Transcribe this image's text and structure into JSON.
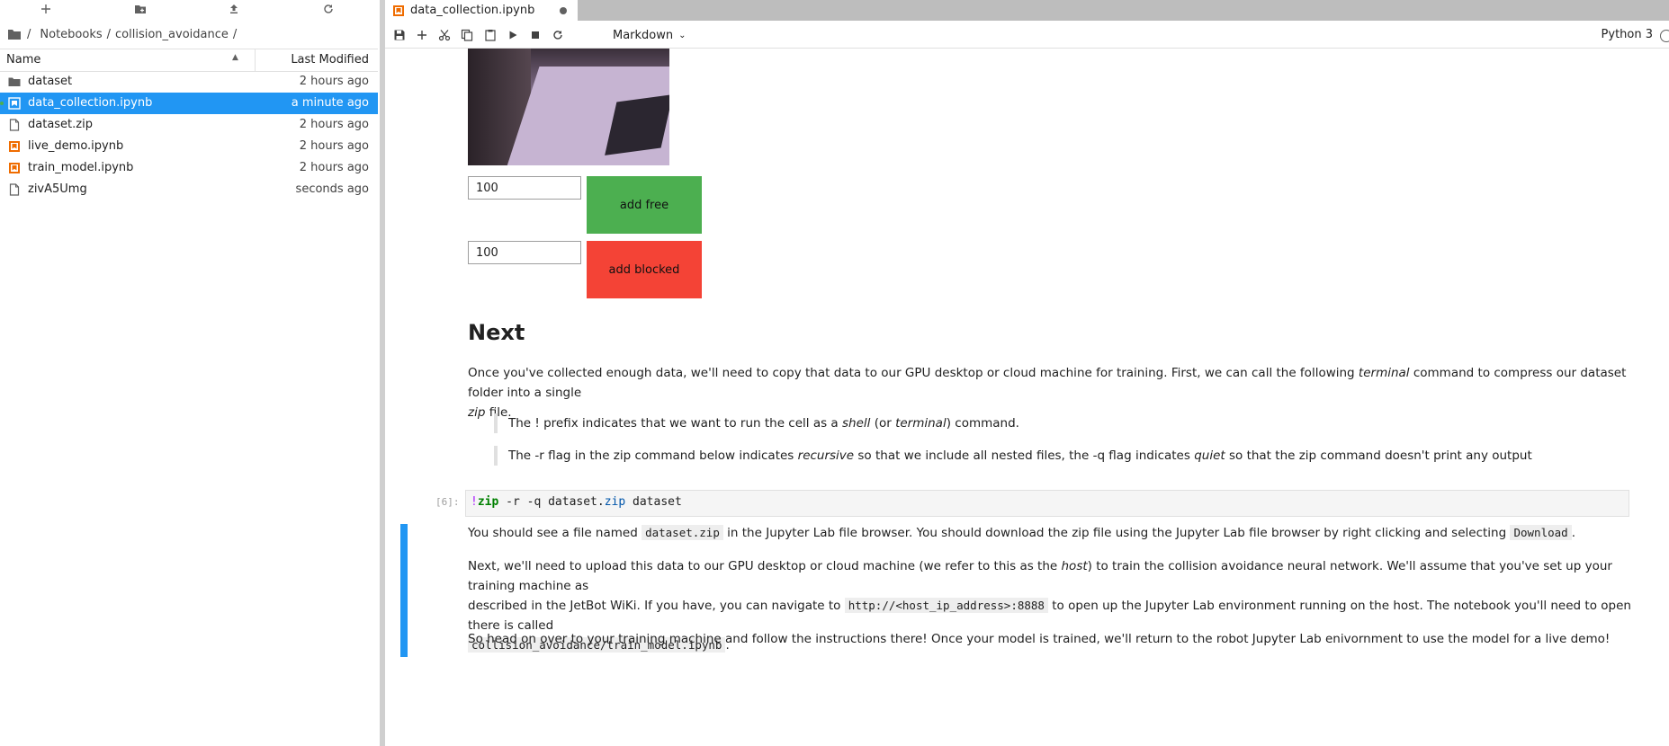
{
  "file_browser": {
    "toolbar": [
      {
        "name": "new-launcher-icon"
      },
      {
        "name": "new-folder-icon"
      },
      {
        "name": "upload-icon"
      },
      {
        "name": "refresh-icon"
      }
    ],
    "breadcrumb": {
      "root": "/",
      "parts": [
        "Notebooks",
        "collision_avoidance"
      ],
      "trailing": "/"
    },
    "header": {
      "name": "Name",
      "modified": "Last Modified"
    },
    "files": [
      {
        "name": "dataset",
        "modified": "2 hours ago",
        "icon": "folder-icon",
        "color": "#616161"
      },
      {
        "name": "data_collection.ipynb",
        "modified": "a minute ago",
        "icon": "notebook-icon",
        "color": "#ffffff",
        "selected": true
      },
      {
        "name": "dataset.zip",
        "modified": "2 hours ago",
        "icon": "file-icon",
        "color": "#616161"
      },
      {
        "name": "live_demo.ipynb",
        "modified": "2 hours ago",
        "icon": "notebook-icon",
        "color": "#ef6c00"
      },
      {
        "name": "train_model.ipynb",
        "modified": "2 hours ago",
        "icon": "notebook-icon",
        "color": "#ef6c00"
      },
      {
        "name": "zivA5Umg",
        "modified": "seconds ago",
        "icon": "file-icon",
        "color": "#616161"
      }
    ]
  },
  "notebook": {
    "tab": {
      "title": "data_collection.ipynb"
    },
    "toolbar": {
      "tools": [
        "save-icon",
        "add-cell-icon",
        "cut-icon",
        "copy-icon",
        "paste-icon",
        "run-icon",
        "stop-icon",
        "restart-icon"
      ],
      "cell_type": "Markdown",
      "kernel": "Python 3"
    },
    "widgets": {
      "free_value": "100",
      "free_label": "add free",
      "blocked_value": "100",
      "blocked_label": "add blocked",
      "free_color": "#4caf50",
      "blocked_color": "#f44336"
    },
    "next_heading": "Next",
    "p1": {
      "a": "Once you've collected enough data, we'll need to copy that data to our GPU desktop or cloud machine for training. First, we can call the following ",
      "em1": "terminal",
      "b": " command to compress our dataset folder into a single",
      "em2": "zip",
      "c": " file."
    },
    "quote1": {
      "a": "The ! prefix indicates that we want to run the cell as a ",
      "em1": "shell",
      "b": " (or ",
      "em2": "terminal",
      "c": ") command."
    },
    "quote2": {
      "a": "The -r flag in the zip command below indicates ",
      "em1": "recursive",
      "b": " so that we include all nested files, the -q flag indicates ",
      "em2": "quiet",
      "c": " so that the zip command doesn't print any output"
    },
    "code_cell": {
      "prompt": "[6]:",
      "bang": "!",
      "zip": "zip",
      "flags": " -r -q dataset.",
      "ext": "zip",
      "rest": " dataset"
    },
    "p2": {
      "a": "You should see a file named ",
      "code1": "dataset.zip",
      "b": " in the Jupyter Lab file browser. You should download the zip file using the Jupyter Lab file browser by right clicking and selecting ",
      "code2": "Download",
      "c": "."
    },
    "p3": {
      "a": "Next, we'll need to upload this data to our GPU desktop or cloud machine (we refer to this as the ",
      "em1": "host",
      "b": ") to train the collision avoidance neural network. We'll assume that you've set up your training machine as",
      "c": "described in the JetBot WiKi. If you have, you can navigate to ",
      "code1": "http://<host_ip_address>:8888",
      "d": " to open up the Jupyter Lab environment running on the host. The notebook you'll need to open there is called",
      "code2": "collision_avoidance/train_model.ipynb",
      "e": "."
    },
    "p4": "So head on over to your training machine and follow the instructions there! Once your model is trained, we'll return to the robot Jupyter Lab enivornment to use the model for a live demo!"
  }
}
